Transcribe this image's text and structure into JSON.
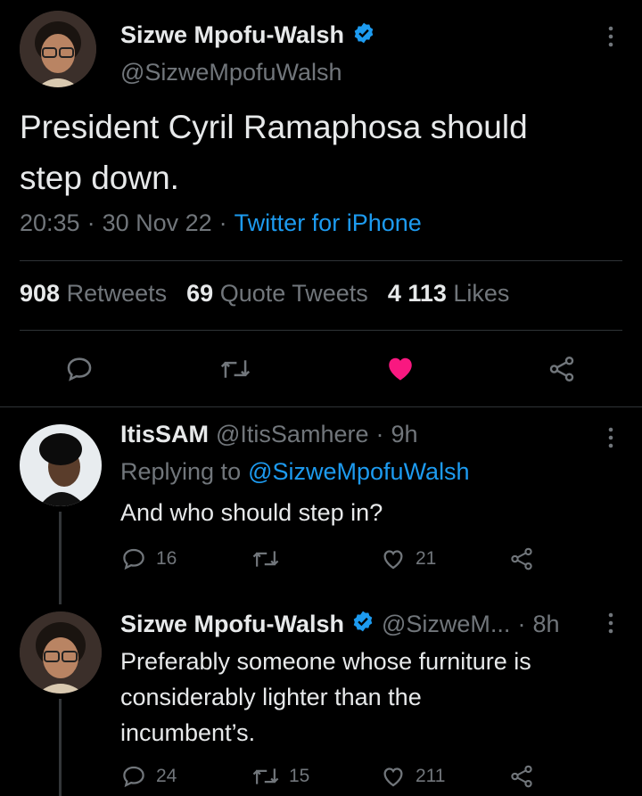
{
  "main_tweet": {
    "display_name": "Sizwe Mpofu-Walsh",
    "handle": "@SizweMpofuWalsh",
    "text_line1": "President Cyril Ramaphosa should",
    "text_line2": "step down.",
    "time": "20:35",
    "date": "30 Nov 22",
    "source": "Twitter for iPhone",
    "retweets_count": "908",
    "retweets_label": "Retweets",
    "quotes_count": "69",
    "quotes_label": "Quote Tweets",
    "likes_count": "4 113",
    "likes_label": "Likes",
    "liked": true
  },
  "replies": [
    {
      "display_name": "ItisSAM",
      "handle": "@ItisSamhere",
      "time": "9h",
      "replying_prefix": "Replying to",
      "replying_to": "@SizweMpofuWalsh",
      "text_lines": [
        "And who should step in?"
      ],
      "reply_count": "16",
      "retweet_count": "",
      "like_count": "21"
    },
    {
      "display_name": "Sizwe Mpofu-Walsh",
      "handle": "@SizweM...",
      "time": "8h",
      "text_lines": [
        "Preferably someone whose furniture is",
        "considerably lighter than the",
        "incumbent’s."
      ],
      "reply_count": "24",
      "retweet_count": "15",
      "like_count": "211"
    }
  ],
  "separator": "·",
  "colors": {
    "background": "#000000",
    "text": "#e7e9ea",
    "muted": "#71767b",
    "link": "#1d9bf0",
    "like": "#f91880",
    "divider": "#2f3336"
  }
}
